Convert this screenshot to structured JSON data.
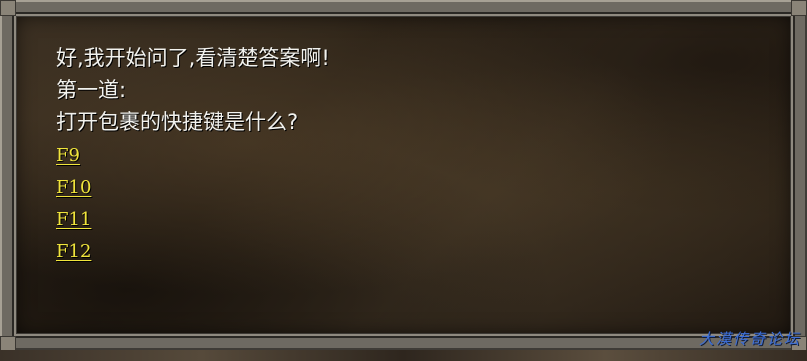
{
  "dialog": {
    "lines": [
      "好,我开始问了,看清楚答案啊!",
      "第一道:",
      "打开包裹的快捷键是什么?"
    ],
    "options": [
      "F9",
      "F10",
      "F11",
      "F12"
    ]
  },
  "watermark": "大漠传奇论坛",
  "colors": {
    "text": "#f2f2ee",
    "option": "#f1e53c",
    "frame": "#6e6a62",
    "watermark": "#3d6fd8"
  }
}
